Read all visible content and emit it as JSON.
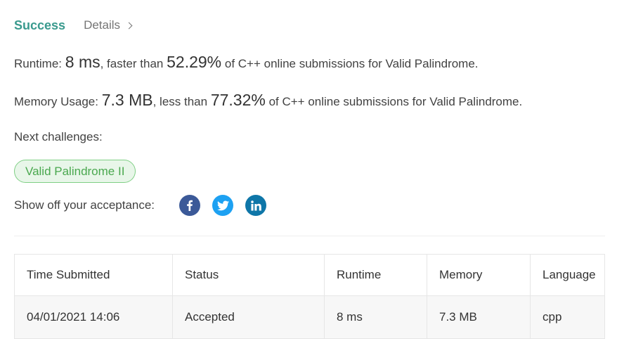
{
  "header": {
    "status": "Success",
    "details_label": "Details"
  },
  "runtime": {
    "label": "Runtime:",
    "value": "8 ms",
    "compare_text": ", faster than",
    "percent": "52.29%",
    "suffix": "of C++ online submissions for Valid Palindrome."
  },
  "memory": {
    "label": "Memory Usage:",
    "value": "7.3 MB",
    "compare_text": ", less than",
    "percent": "77.32%",
    "suffix": "of C++ online submissions for Valid Palindrome."
  },
  "next_challenges": {
    "label": "Next challenges:",
    "items": [
      "Valid Palindrome II"
    ]
  },
  "share": {
    "label": "Show off your acceptance:",
    "icons": [
      "facebook-icon",
      "twitter-icon",
      "linkedin-icon"
    ]
  },
  "submissions": {
    "columns": [
      "Time Submitted",
      "Status",
      "Runtime",
      "Memory",
      "Language"
    ],
    "rows": [
      {
        "time": "04/01/2021 14:06",
        "status": "Accepted",
        "runtime": "8 ms",
        "memory": "7.3 MB",
        "language": "cpp"
      }
    ]
  },
  "colors": {
    "success": "#3a9a8e",
    "accepted": "#3a9a8e",
    "pill_border": "#7fcf85",
    "pill_bg": "#e8f6e9",
    "pill_text": "#4aa84f",
    "facebook": "#3b5998",
    "twitter": "#1da1f2",
    "linkedin": "#0e76a8"
  }
}
